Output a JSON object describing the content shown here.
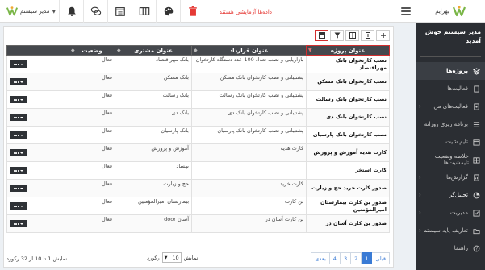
{
  "app": {
    "brand": "بهرایم",
    "user": "مدیر سیستم",
    "demo_badge": "داده‌ها آزمایشی هستند"
  },
  "sidebar": {
    "welcome": "مدیر سیستم خوش آمدید",
    "items": [
      {
        "label": "پروژه‌ها",
        "icon": "stacks-icon"
      },
      {
        "label": "فعالیت‌ها",
        "icon": "file-icon"
      },
      {
        "label": "فعالیت‌های من",
        "icon": "file-user-icon"
      },
      {
        "label": "برنامه ریزی روزانه",
        "icon": "list-icon"
      },
      {
        "label": "تایم شیت",
        "icon": "calendar-icon"
      },
      {
        "label": "خلاصه وضعیت تایمشیت‌ها",
        "icon": "table-icon"
      },
      {
        "label": "گزارش‌ها",
        "icon": "file-chart-icon"
      },
      {
        "label": "تحلیل‌گر",
        "icon": "pie-chart-icon"
      },
      {
        "label": "مدیریت",
        "icon": "check-square-icon"
      },
      {
        "label": "تعاریف پایه سیستم",
        "icon": "folder-icon"
      },
      {
        "label": "راهنما",
        "icon": "help-icon"
      }
    ]
  },
  "table": {
    "headers": [
      "عنوان پروژه",
      "عنوان قرارداد",
      "عنوان مشتری",
      "وضعیت"
    ],
    "rows": [
      {
        "project": "نصب کارتخوان بانک مهراقتصاد",
        "contract": "بازاریابی و نصب تعداد 100 عدد دستگاه کارتخوان",
        "customer": "بانک مهراقتصاد",
        "status": "فعال"
      },
      {
        "project": "نصب کارتخوان بانک مسکن",
        "contract": "پشتیبانی و نصب کارتخوان بانک مسکن",
        "customer": "بانک مسکن",
        "status": "فعال"
      },
      {
        "project": "نصب کارتخوان بانک رسالت",
        "contract": "پشتیبانی و نصب کارتخوان بانک رسالت",
        "customer": "بانک رسالت",
        "status": "فعال"
      },
      {
        "project": "نصب کارتخوان بانک دی",
        "contract": "پشتیبانی و نصب کارتخوان بانک دی",
        "customer": "بانک دی",
        "status": "فعال"
      },
      {
        "project": "نصب کارتخوان بانک پارسیان",
        "contract": "پشتیبانی و نصب کارتخوان بانک پارسیان",
        "customer": "بانک پارسیان",
        "status": "فعال"
      },
      {
        "project": "کارت هدیه آموزش و پرورش",
        "contract": "کارت هدیه",
        "customer": "آموزش و پرورش",
        "status": "فعال"
      },
      {
        "project": "کارت استخر",
        "contract": "",
        "customer": "بهساد",
        "status": "فعال"
      },
      {
        "project": "صدور کارت خرید حج و زیارت",
        "contract": "کارت خرید",
        "customer": "حج و زیارت",
        "status": "فعال"
      },
      {
        "project": "صدور بن کارت بیمارستان امیرالمؤمنین",
        "contract": "بن کارت",
        "customer": "بیمارستان امیرالمؤمنین",
        "status": "فعال"
      },
      {
        "project": "صدور بن کارت آسان در",
        "contract": "بن کارت آسان در",
        "customer": "آسان door",
        "status": "فعال"
      }
    ]
  },
  "pager": {
    "prev": "قبلی",
    "pages": [
      "1",
      "2",
      "3",
      "4"
    ],
    "current_page": 1,
    "next": "بعدی",
    "page_size_label": "نمایش",
    "page_size": "10",
    "records_suffix": "رکورد",
    "record_info": "نمایش 1 تا 10 از 32 رکورد"
  },
  "colors": {
    "sidebar_bg": "#2b2e33",
    "header_bg": "#45484d",
    "accent": "#3a7bd5",
    "selected_outline": "#d32f2f",
    "demo_text": "#e53935"
  }
}
